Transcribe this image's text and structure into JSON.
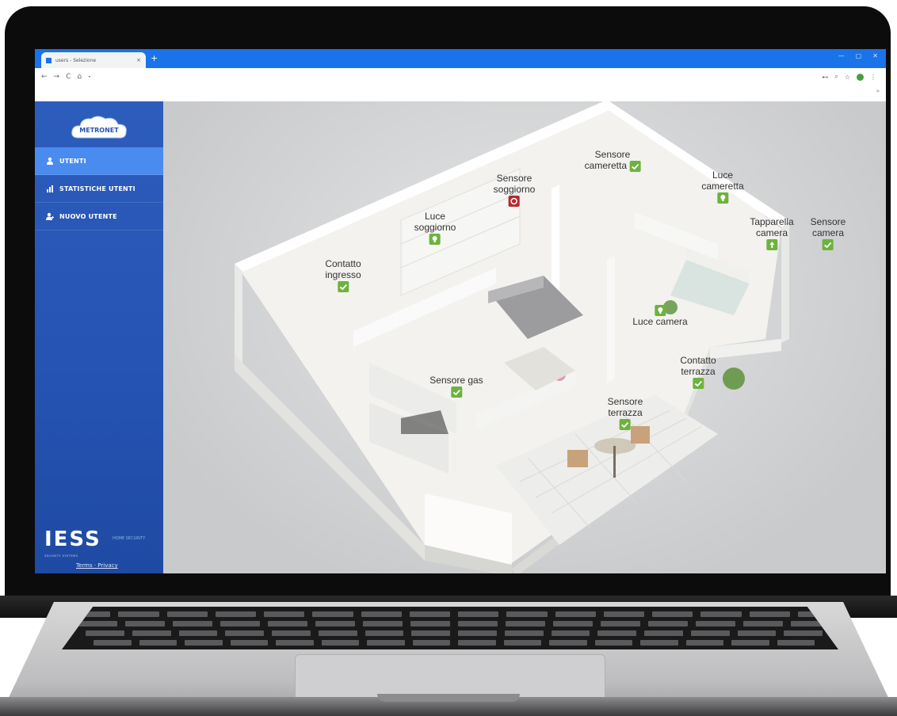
{
  "browser": {
    "tab_title": "users - Selezione",
    "tab_close": "×",
    "new_tab": "+",
    "window_controls": [
      "—",
      "▢",
      "✕"
    ],
    "nav": {
      "back": "←",
      "forward": "→",
      "reload": "C",
      "home": "⌂"
    },
    "omnibox_text": "•",
    "toolbar_icons": [
      "⊷",
      "⌕",
      "☆"
    ],
    "menu_dots": "⋮",
    "sub_icon": "»"
  },
  "sidebar": {
    "logo_text": "METRONET",
    "items": [
      {
        "label": "UTENTI",
        "icon": "user-icon",
        "active": true
      },
      {
        "label": "STATISTICHE UTENTI",
        "icon": "chart-icon",
        "active": false
      },
      {
        "label": "NUOVO UTENTE",
        "icon": "add-user-icon",
        "active": false
      }
    ],
    "brand": "IESS",
    "brand_tag": "HOME SECURITY",
    "brand_sub": "SECURITY SYSTEMS",
    "footer_links": "Terms · Privacy"
  },
  "devices": [
    {
      "line1": "Sensore",
      "line2": "cameretta",
      "status": "ok"
    },
    {
      "line1": "Sensore",
      "line2": "soggiorno",
      "status": "alarm"
    },
    {
      "line1": "Luce",
      "line2": "cameretta",
      "status": "light"
    },
    {
      "line1": "Luce",
      "line2": "soggiorno",
      "status": "light"
    },
    {
      "line1": "Tapparella",
      "line2": "camera",
      "status": "up"
    },
    {
      "line1": "Sensore",
      "line2": "camera",
      "status": "ok"
    },
    {
      "line1": "Contatto",
      "line2": "ingresso",
      "status": "ok"
    },
    {
      "line1": "Luce camera",
      "line2": "",
      "status": "light"
    },
    {
      "line1": "Contatto",
      "line2": "terrazza",
      "status": "ok"
    },
    {
      "line1": "Sensore gas",
      "line2": "",
      "status": "ok"
    },
    {
      "line1": "Sensore",
      "line2": "terrazza",
      "status": "ok"
    }
  ],
  "colors": {
    "ok": "#6cb33e",
    "alarm": "#b7272d",
    "sidebar": "#2553b3",
    "active": "#4a8bf0"
  }
}
